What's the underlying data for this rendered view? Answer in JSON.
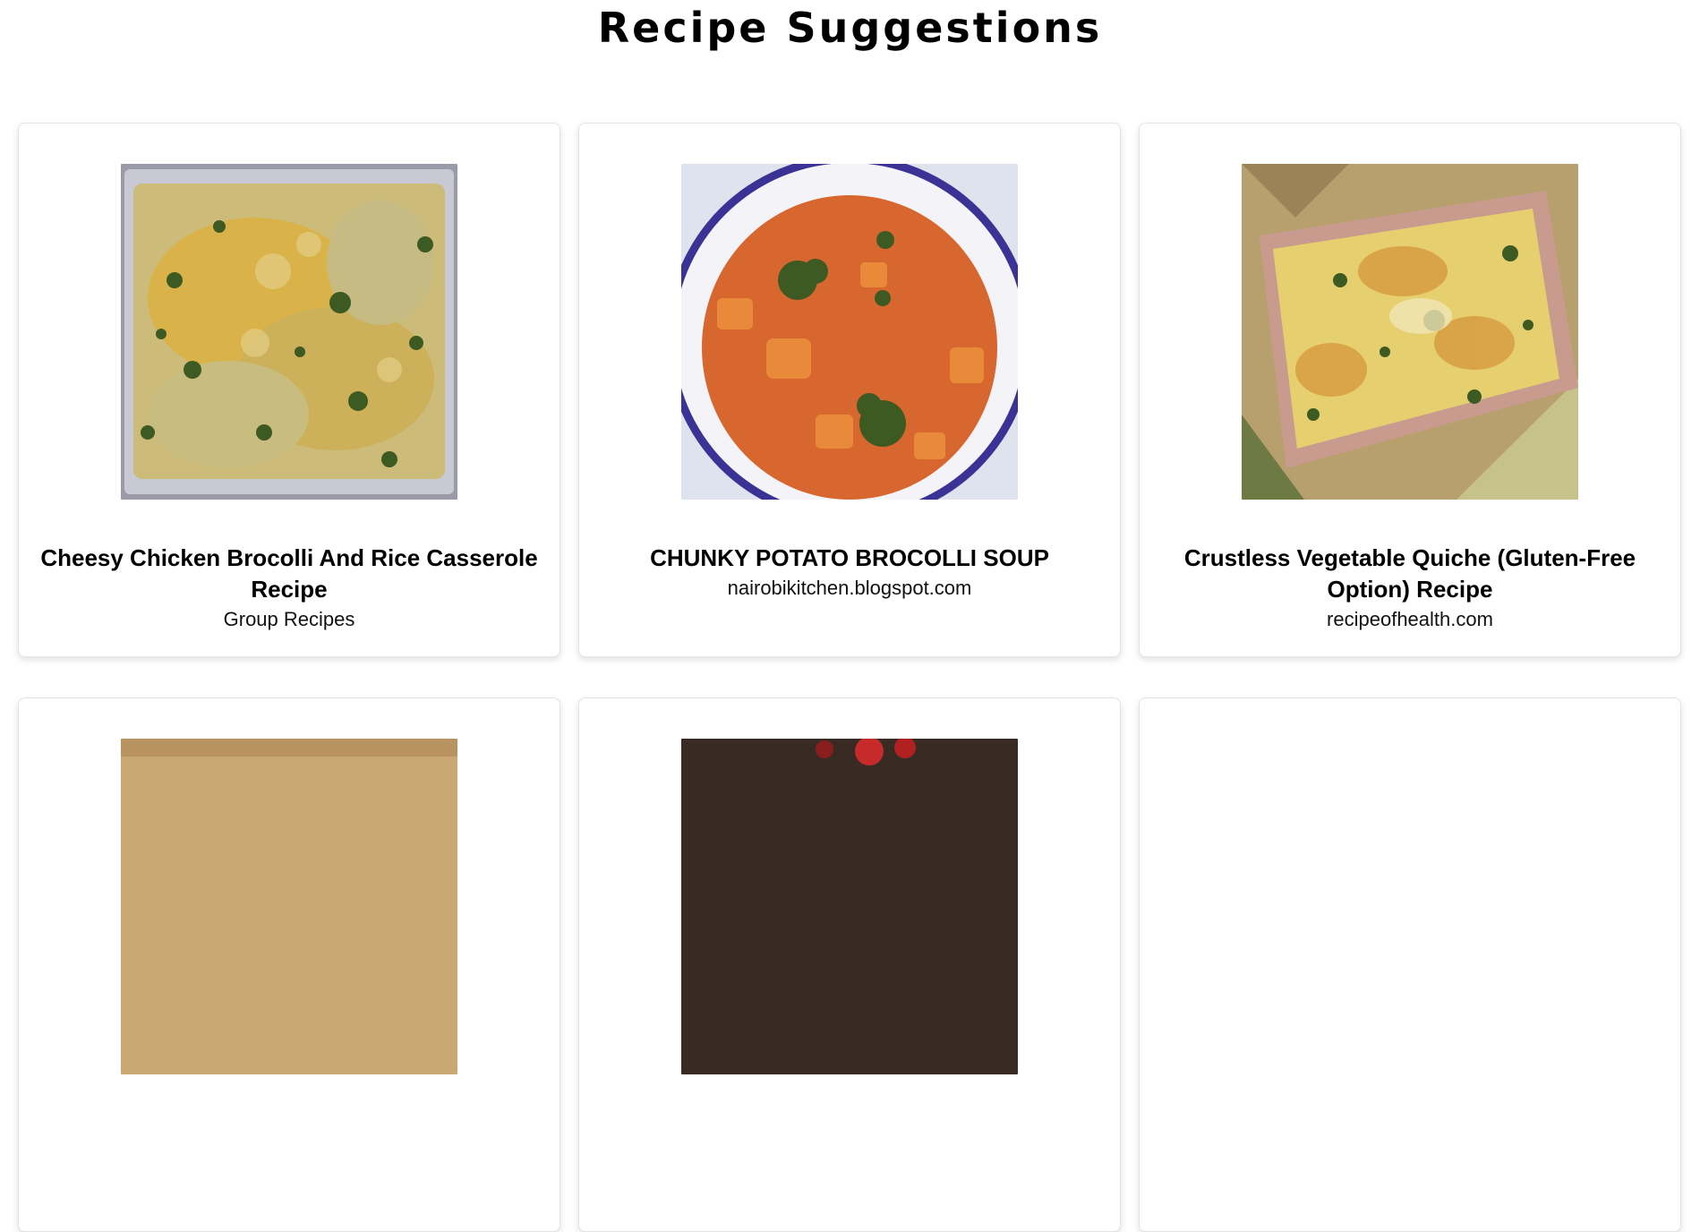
{
  "page": {
    "title": "Recipe Suggestions"
  },
  "recipes": [
    {
      "title": "Cheesy Chicken Brocolli And Rice Casserole Recipe",
      "source": "Group Recipes",
      "image_icon": "casserole-photo-icon"
    },
    {
      "title": "CHUNKY POTATO BROCOLLI SOUP",
      "source": "nairobikitchen.blogspot.com",
      "image_icon": "soup-bowl-photo-icon"
    },
    {
      "title": "Crustless Vegetable Quiche (Gluten-Free Option) Recipe",
      "source": "recipeofhealth.com",
      "image_icon": "quiche-dish-photo-icon"
    }
  ],
  "colors": {
    "card_border": "#e4e4e4",
    "cheese": "#d9b34a",
    "broccoli": "#3e5a23",
    "soup": "#d8662f",
    "bowl_rim": "#3b3296",
    "quiche_dish": "#c99b8e"
  }
}
